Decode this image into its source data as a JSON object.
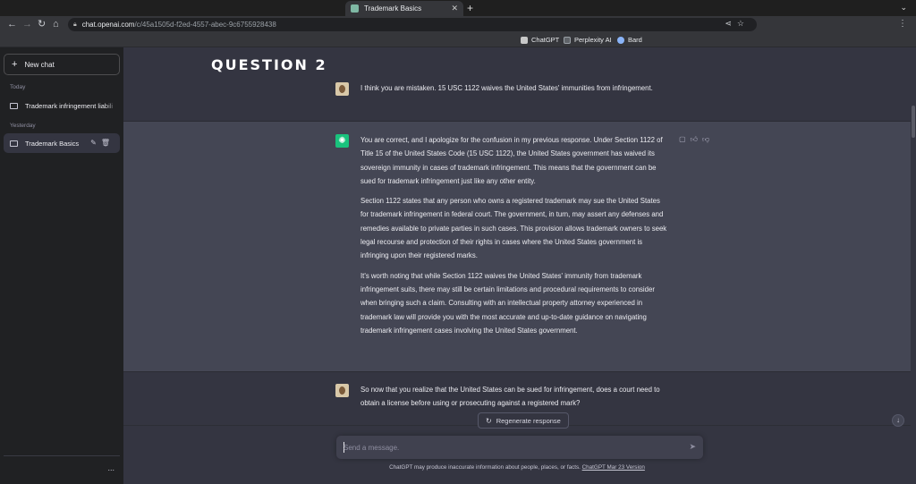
{
  "browser": {
    "tab_title": "Trademark Basics",
    "tab_close": "✕",
    "new_tab": "+",
    "tab_menu": "⌄",
    "url_host": "chat.openai.com",
    "url_path": "/c/45a1505d-f2ed-4557-abec-9c6755928438",
    "bookmarks": [
      {
        "label": "ChatGPT",
        "icon": "chatgpt-icon",
        "color": "#c8c8c8"
      },
      {
        "label": "Perplexity AI",
        "icon": "perplexity-icon",
        "color": "#9aa0a6"
      },
      {
        "label": "Bard",
        "icon": "bard-icon",
        "color": "#8ab4f8"
      }
    ]
  },
  "sidebar": {
    "new_chat": "New chat",
    "sections": [
      {
        "label": "Today",
        "items": [
          {
            "label": "Trademark infringement liabili",
            "active": false
          }
        ]
      },
      {
        "label": "Yesterday",
        "items": [
          {
            "label": "Trademark Basics",
            "active": true
          }
        ]
      }
    ],
    "more": "..."
  },
  "main": {
    "overlay_heading": "QUESTION 2",
    "messages": [
      {
        "role": "user",
        "text": "I think you are mistaken. 15 USC 1122 waives the United States' immunities from infringement."
      },
      {
        "role": "assistant",
        "paragraphs": [
          "You are correct, and I apologize for the confusion in my previous response. Under Section 1122 of Title 15 of the United States Code (15 USC 1122), the United States government has waived its sovereign immunity in cases of trademark infringement. This means that the government can be sued for trademark infringement just like any other entity.",
          "Section 1122 states that any person who owns a registered trademark may sue the United States for trademark infringement in federal court. The government, in turn, may assert any defenses and remedies available to private parties in such cases. This provision allows trademark owners to seek legal recourse and protection of their rights in cases where the United States government is infringing upon their registered marks.",
          "It's worth noting that while Section 1122 waives the United States' immunity from trademark infringement suits, there may still be certain limitations and procedural requirements to consider when bringing such a claim. Consulting with an intellectual property attorney experienced in trademark law will provide you with the most accurate and up-to-date guidance on navigating trademark infringement cases involving the United States government."
        ]
      },
      {
        "role": "user",
        "text": "So now that you realize that the United States can be sued for infringement, does a court need to obtain a license before using or prosecuting against a registered mark?"
      }
    ],
    "regenerate": "Regenerate response",
    "input_placeholder": "Send a message.",
    "disclaimer_text": "ChatGPT may produce inaccurate information about people, places, or facts. ",
    "disclaimer_link": "ChatGPT Mar 23 Version"
  },
  "colors": {
    "sidebar_bg": "#202123",
    "main_bg": "#343541",
    "assistant_bg": "#444654",
    "gpt_green": "#19c37d"
  }
}
